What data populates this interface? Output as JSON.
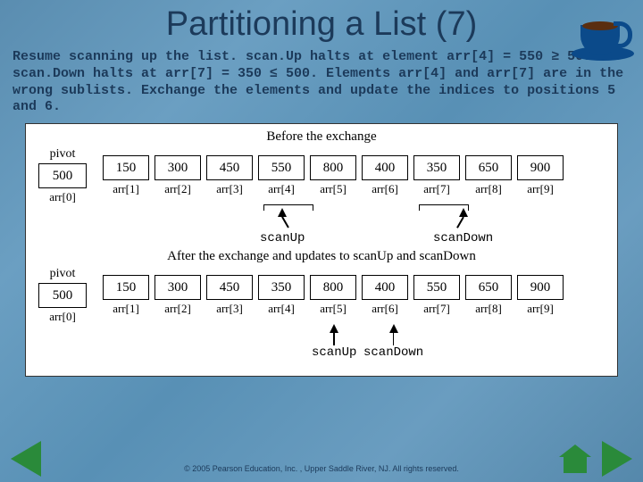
{
  "title": "Partitioning a List (7)",
  "description": "Resume scanning up the list. scan.Up halts at element arr[4] = 550 ≥ 500. scan.Down halts at arr[7] = 350 ≤ 500. Elements arr[4] and arr[7] are in the wrong sublists. Exchange the elements and update the indices to positions 5 and 6.",
  "before": {
    "caption": "Before the exchange",
    "pivot_label": "pivot",
    "pivot_value": "500",
    "values": [
      "150",
      "300",
      "450",
      "550",
      "800",
      "400",
      "350",
      "650",
      "900"
    ],
    "labels": [
      "arr[1]",
      "arr[2]",
      "arr[3]",
      "arr[4]",
      "arr[5]",
      "arr[6]",
      "arr[7]",
      "arr[8]",
      "arr[9]"
    ],
    "arr0_label": "arr[0]",
    "scanUp": {
      "label": "scanUp",
      "bracket_start": 3,
      "bracket_end": 4
    },
    "scanDown": {
      "label": "scanDown",
      "bracket_start": 6,
      "bracket_end": 7
    }
  },
  "after": {
    "caption": "After the exchange and updates to scanUp and scanDown",
    "pivot_label": "pivot",
    "pivot_value": "500",
    "values": [
      "150",
      "300",
      "450",
      "350",
      "800",
      "400",
      "550",
      "650",
      "900"
    ],
    "labels": [
      "arr[1]",
      "arr[2]",
      "arr[3]",
      "arr[4]",
      "arr[5]",
      "arr[6]",
      "arr[7]",
      "arr[8]",
      "arr[9]"
    ],
    "arr0_label": "arr[0]",
    "scanUp": {
      "label": "scanUp",
      "index": 4
    },
    "scanDown": {
      "label": "scanDown",
      "index": 5
    }
  },
  "chart_data": [
    {
      "type": "table",
      "title": "Before the exchange",
      "pivot": 500,
      "indices": [
        0,
        1,
        2,
        3,
        4,
        5,
        6,
        7,
        8,
        9
      ],
      "array": [
        500,
        150,
        300,
        450,
        550,
        800,
        400,
        350,
        650,
        900
      ],
      "scanUp_index": 4,
      "scanDown_index": 7
    },
    {
      "type": "table",
      "title": "After the exchange and updates to scanUp and scanDown",
      "pivot": 500,
      "indices": [
        0,
        1,
        2,
        3,
        4,
        5,
        6,
        7,
        8,
        9
      ],
      "array": [
        500,
        150,
        300,
        450,
        350,
        800,
        400,
        550,
        650,
        900
      ],
      "scanUp_index": 5,
      "scanDown_index": 6
    }
  ],
  "footer": "© 2005 Pearson Education, Inc. , Upper Saddle River, NJ.  All rights reserved."
}
